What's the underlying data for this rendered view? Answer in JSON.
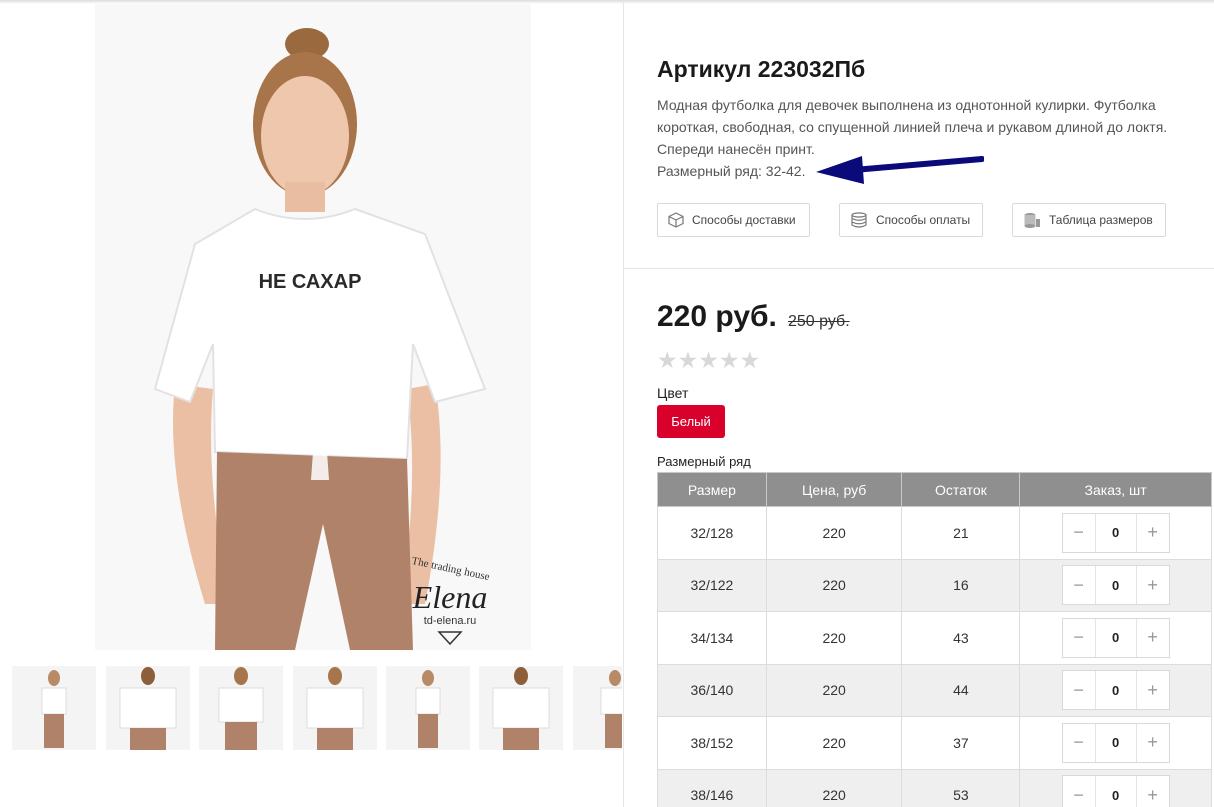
{
  "product": {
    "title": "Артикул 223032Пб",
    "description": [
      "Модная футболка для девочек выполнена из однотонной кулирки. Футболка",
      "короткая, свободная, со спущенной линией плеча и рукавом длиной до локтя.",
      "Спереди нанесён принт.",
      "Размерный ряд: 32-42."
    ],
    "shirt_print": "НЕ САХАР",
    "watermark": {
      "line1": "The trading house",
      "brand": "Elena",
      "site": "td-elena.ru"
    }
  },
  "info_buttons": [
    {
      "label": "Способы доставки",
      "icon": "box-icon"
    },
    {
      "label": "Способы оплаты",
      "icon": "coins-icon"
    },
    {
      "label": "Таблица размеров",
      "icon": "database-icon"
    }
  ],
  "pricing": {
    "price": "220 руб.",
    "old_price": "250 руб.",
    "rating_stars": "★★★★★",
    "rating_value": 0
  },
  "color": {
    "label": "Цвет",
    "selected": "Белый",
    "accent": "#d9002b"
  },
  "sizes": {
    "label": "Размерный ряд",
    "headers": [
      "Размер",
      "Цена, руб",
      "Остаток",
      "Заказ, шт"
    ],
    "rows": [
      {
        "size": "32/128",
        "price": "220",
        "stock": "21",
        "qty": "0"
      },
      {
        "size": "32/122",
        "price": "220",
        "stock": "16",
        "qty": "0"
      },
      {
        "size": "34/134",
        "price": "220",
        "stock": "43",
        "qty": "0"
      },
      {
        "size": "36/140",
        "price": "220",
        "stock": "44",
        "qty": "0"
      },
      {
        "size": "38/152",
        "price": "220",
        "stock": "37",
        "qty": "0"
      },
      {
        "size": "38/146",
        "price": "220",
        "stock": "53",
        "qty": "0"
      }
    ],
    "minus": "−",
    "plus": "+"
  },
  "colors": {
    "header_bg": "#8f8f8f",
    "alt_row_bg": "#f0efef",
    "arrow": "#0a0a7a"
  }
}
